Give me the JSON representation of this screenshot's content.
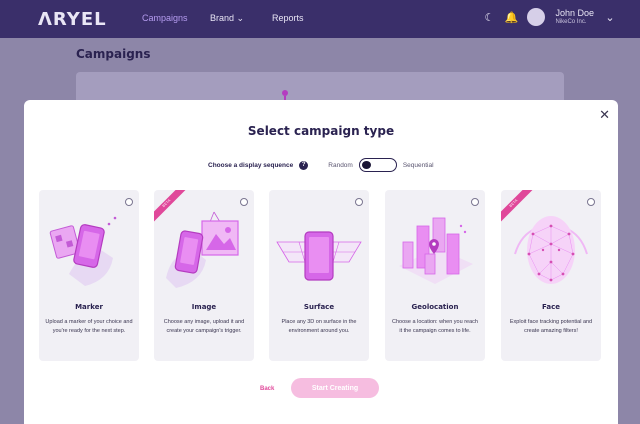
{
  "header": {
    "logo": "ΛRYEL",
    "nav": [
      "Campaigns",
      "Brand",
      "Reports"
    ],
    "user_name": "John Doe",
    "user_company": "NikeCo Inc."
  },
  "page": {
    "title": "Campaigns"
  },
  "modal": {
    "title": "Select campaign type",
    "sequence_label": "Choose a display sequence",
    "help": "?",
    "option_left": "Random",
    "option_right": "Sequential",
    "close": "✕",
    "cards": [
      {
        "title": "Marker",
        "description": "Upload a marker of your choice and you're ready for the next step.",
        "beta": false
      },
      {
        "title": "Image",
        "description": "Choose any image, upload it and create your campaign's trigger.",
        "beta": true,
        "badge": "BETA"
      },
      {
        "title": "Surface",
        "description": "Place any 3D on surface in the environment around you.",
        "beta": false
      },
      {
        "title": "Geolocation",
        "description": "Choose a location: when you reach it the campaign comes to life.",
        "beta": false
      },
      {
        "title": "Face",
        "description": "Exploit face tracking potential and create amazing filters!",
        "beta": true,
        "badge": "BETA"
      }
    ],
    "back_label": "Back",
    "start_label": "Start Creating"
  },
  "colors": {
    "accent": "#e0489a",
    "primary": "#2a2250",
    "illustration": "#d667e8"
  }
}
